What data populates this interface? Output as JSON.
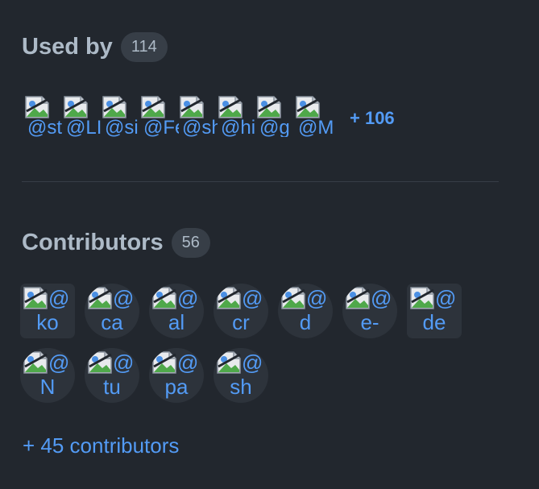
{
  "used_by": {
    "title": "Used by",
    "count": "114",
    "dependents": [
      {
        "text": "@st"
      },
      {
        "text": "@LI"
      },
      {
        "text": "@si"
      },
      {
        "text": "@Fe"
      },
      {
        "text": "@sh"
      },
      {
        "text": "@hi"
      },
      {
        "text": "@g"
      },
      {
        "text": "@M"
      }
    ],
    "more_label": "+ 106",
    "icon": "broken-image-icon"
  },
  "contributors": {
    "title": "Contributors",
    "count": "56",
    "people": [
      {
        "at": "@",
        "login": "ko"
      },
      {
        "at": "@",
        "login": "ca"
      },
      {
        "at": "@",
        "login": "al"
      },
      {
        "at": "@",
        "login": "cr"
      },
      {
        "at": "@",
        "login": "d"
      },
      {
        "at": "@",
        "login": "e-"
      },
      {
        "at": "@",
        "login": "de"
      },
      {
        "at": "@",
        "login": "N"
      },
      {
        "at": "@",
        "login": "tu"
      },
      {
        "at": "@",
        "login": "pa"
      },
      {
        "at": "@",
        "login": "sh"
      }
    ],
    "more_label": "+ 45 contributors"
  },
  "colors": {
    "background": "#22272e",
    "link": "#539bf5",
    "text": "#adbac7",
    "counter_bg": "#373e47"
  }
}
